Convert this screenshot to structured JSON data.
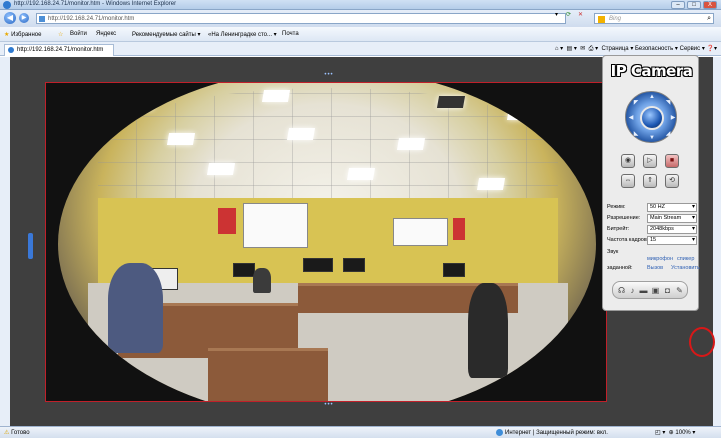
{
  "window": {
    "title": "http://192.168.24.71/monitor.htm - Windows Internet Explorer",
    "buttons": [
      "–",
      "□",
      "X"
    ]
  },
  "address_bar": {
    "url": "http://192.168.24.71/monitor.htm",
    "search_placeholder": "Bing"
  },
  "favorites": {
    "label": "Избранное",
    "items": [
      "Войти",
      "Яндекс",
      "Рекомендуемые сайты ▾",
      "«На Ленинградке сто... ▾",
      "Почта"
    ]
  },
  "tab": {
    "title": "http://192.168.24.71/monitor.htm",
    "tools": "Страница ▾  Безопасность ▾  Сервис ▾"
  },
  "panel": {
    "title": "IP Camera",
    "settings": [
      {
        "label": "Режим:",
        "value": "50 HZ"
      },
      {
        "label": "Разрешение:",
        "value": "Main Stream"
      },
      {
        "label": "Битрейт:",
        "value": "2048kbps"
      },
      {
        "label": "Частота кадров:",
        "value": "15"
      }
    ],
    "sound_label": "Звук",
    "sound_links": [
      "микрофон",
      "спикер"
    ],
    "preset_label": "заданной:",
    "preset_links": [
      "Вызов",
      "Установить"
    ]
  },
  "status": {
    "left": "Готово",
    "mid": "Интернет | Защищенный режим: вкл.",
    "zoom": "100%"
  }
}
